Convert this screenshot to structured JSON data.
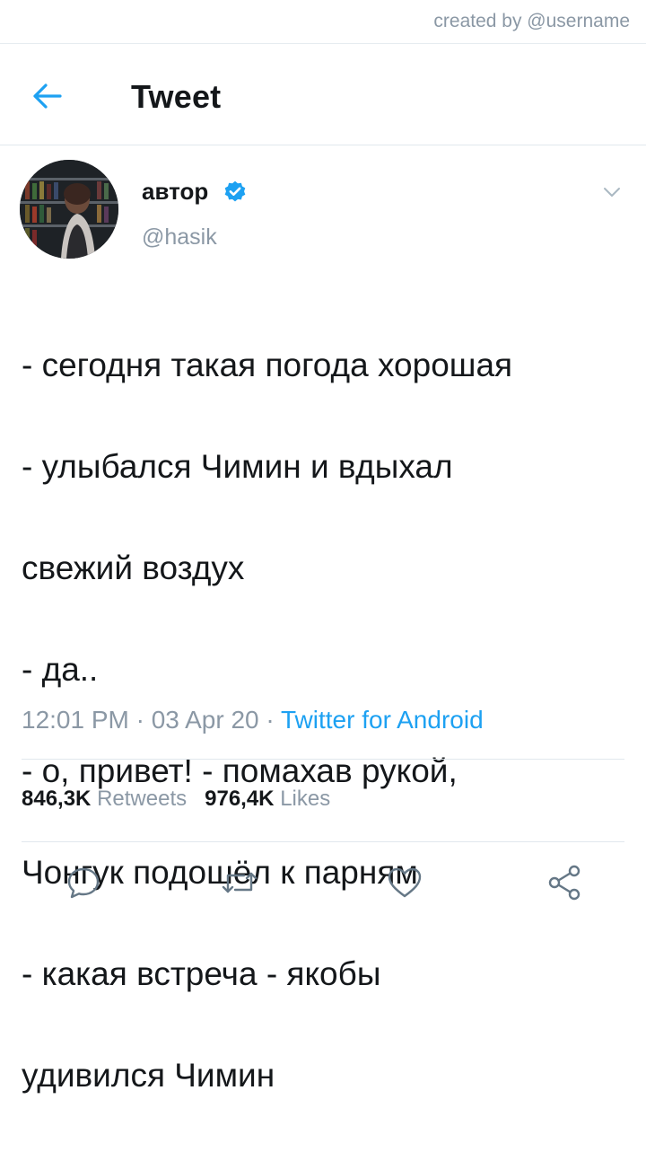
{
  "credit": "created by @username",
  "header": {
    "title": "Tweet",
    "back_icon": "arrow-left-icon"
  },
  "author": {
    "name": "автор",
    "handle": "@hasik",
    "verified_icon": "verified-badge-icon",
    "menu_icon": "chevron-down-icon"
  },
  "tweet": {
    "lines": [
      "- сегодня такая погода хорошая",
      "- улыбался Чимин и вдыхал",
      "свежий воздух",
      "- да..",
      "- о, привет! - помахав рукой,",
      "Чонгук подошёл к парням",
      "- какая встреча - якобы",
      "удивился Чимин"
    ],
    "timestamp": "12:01 PM · 03 Apr 20 · ",
    "source": "Twitter for Android"
  },
  "stats": {
    "retweets_count": "846,3K",
    "retweets_label": "Retweets",
    "likes_count": "976,4K",
    "likes_label": "Likes"
  },
  "actions": [
    "reply-icon",
    "retweet-icon",
    "like-icon",
    "share-icon"
  ],
  "colors": {
    "accent": "#1da1f2",
    "muted": "#8b98a5",
    "text": "#14171a",
    "divider": "#e1e8ed"
  }
}
